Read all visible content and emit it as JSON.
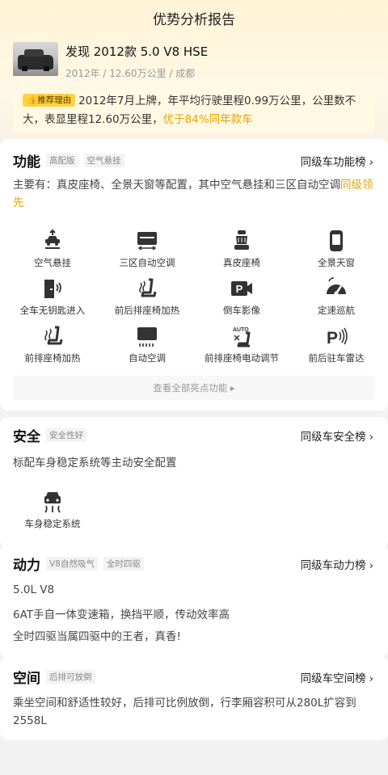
{
  "page": {
    "title": "优势分析报告"
  },
  "car": {
    "name": "发现 2012款 5.0 V8 HSE",
    "meta": "2012年 / 12.60万公里 / 成都"
  },
  "reason": {
    "badge": "推荐理由",
    "text": "2012年7月上牌，年平均行驶里程0.99万公里，公里数不大，表显里程12.60万公里，",
    "highlight": "优于84%同年款车"
  },
  "function": {
    "title": "功能",
    "tags": [
      "高配版",
      "空气悬挂"
    ],
    "rank_label": "同级车功能榜",
    "desc": "主要有：真皮座椅、全景天窗等配置，其中空气悬挂和三区自动空调",
    "desc_highlight": "同级领先",
    "items": [
      {
        "label": "空气悬挂",
        "icon": "air-suspension-icon"
      },
      {
        "label": "三区自动空调",
        "icon": "tri-zone-ac-icon"
      },
      {
        "label": "真皮座椅",
        "icon": "leather-seat-icon"
      },
      {
        "label": "全景天窗",
        "icon": "panoramic-sunroof-icon"
      },
      {
        "label": "全车无钥匙进入",
        "icon": "keyless-entry-icon"
      },
      {
        "label": "前后排座椅加热",
        "icon": "seat-heating-icon"
      },
      {
        "label": "倒车影像",
        "icon": "reverse-camera-icon"
      },
      {
        "label": "定速巡航",
        "icon": "cruise-control-icon"
      },
      {
        "label": "前排座椅加热",
        "icon": "front-seat-heating-icon"
      },
      {
        "label": "自动空调",
        "icon": "auto-ac-icon"
      },
      {
        "label": "前排座椅电动调节",
        "icon": "power-seat-icon"
      },
      {
        "label": "前后驻车雷达",
        "icon": "parking-radar-icon"
      }
    ],
    "more_label": "查看全部亮点功能"
  },
  "safety": {
    "title": "安全",
    "tags": [
      "安全性好"
    ],
    "rank_label": "同级车安全榜",
    "desc": "标配车身稳定系统等主动安全配置",
    "items": [
      {
        "label": "车身稳定系统",
        "icon": "stability-control-icon"
      }
    ]
  },
  "power": {
    "title": "动力",
    "tags": [
      "V8自然吸气",
      "全时四驱"
    ],
    "rank_label": "同级车动力榜",
    "lines": [
      "5.0L V8",
      "6AT手自一体变速箱，换挡平顺，传动效率高",
      "全时四驱当属四驱中的王者，真香!"
    ]
  },
  "space": {
    "title": "空间",
    "tags": [
      "后排可放倒"
    ],
    "rank_label": "同级车空间榜",
    "desc": "乘坐空间和舒适性较好，后排可比例放倒，行李厢容积可从280L扩容到2558L"
  },
  "colors": {
    "accent": "#e6a400",
    "badge": "#ffd23e",
    "hero_bg": "#fff4d6"
  }
}
